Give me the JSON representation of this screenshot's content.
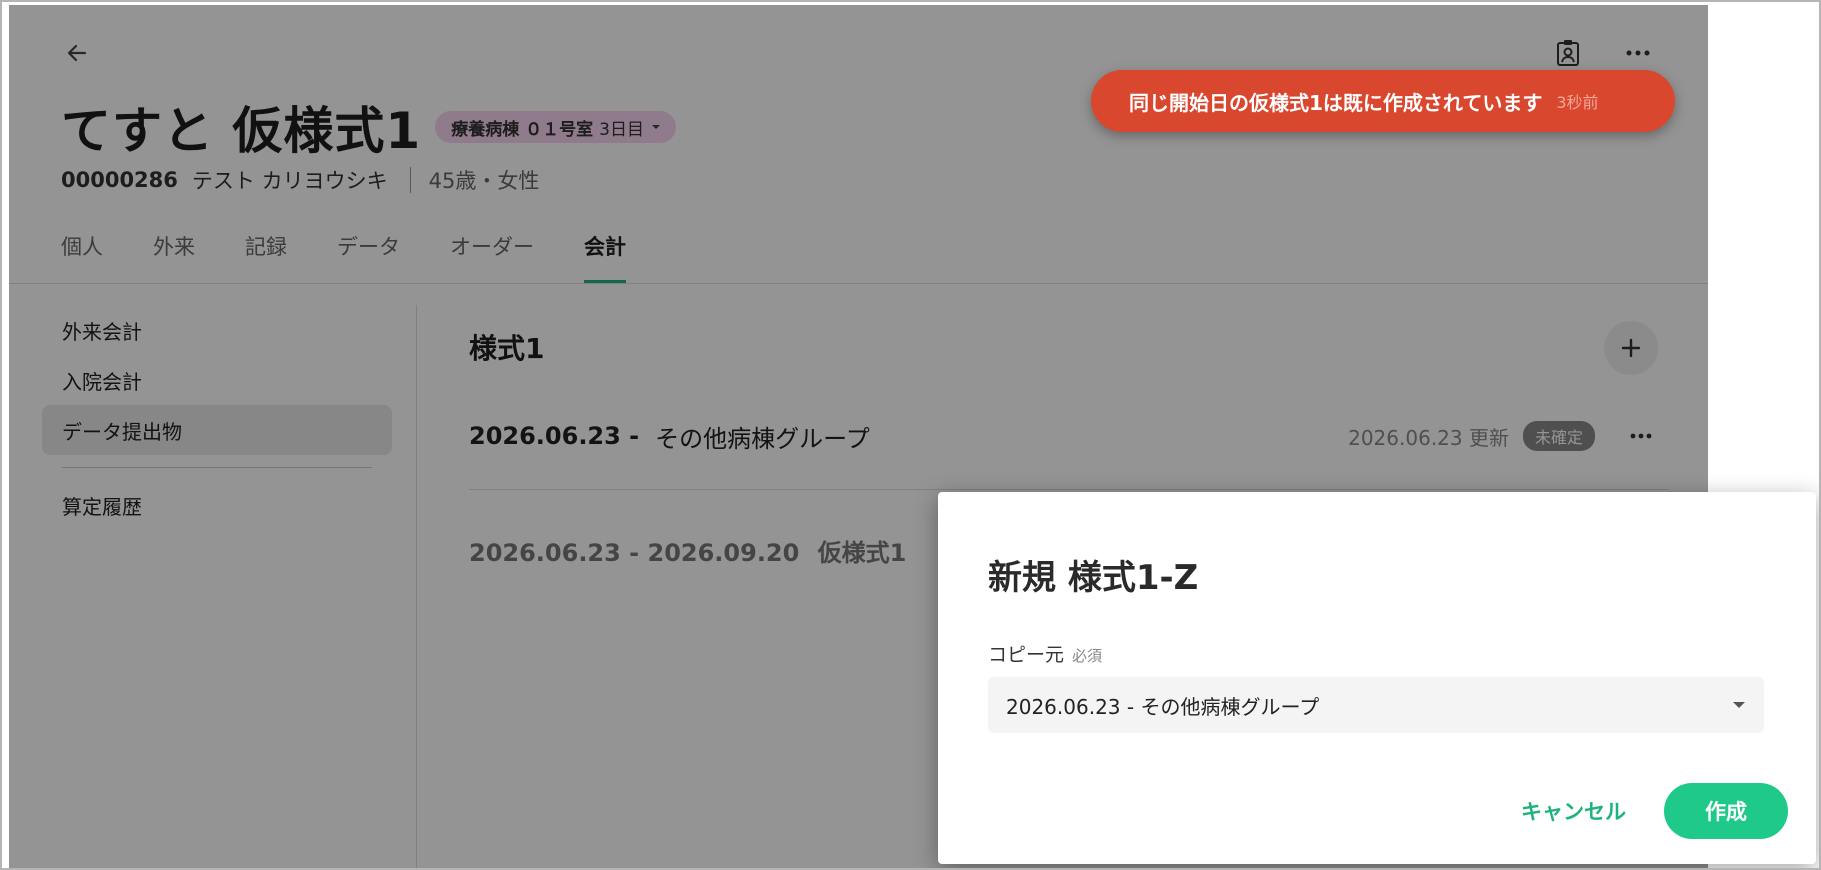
{
  "patient": {
    "name": "てすと 仮様式1",
    "ward_badge": "療養病棟 ０１号室",
    "ward_days": "3日目",
    "id": "00000286",
    "kana": "テスト カリヨウシキ",
    "age_sex": "45歳・女性"
  },
  "tabs": [
    {
      "label": "個人"
    },
    {
      "label": "外来"
    },
    {
      "label": "記録"
    },
    {
      "label": "データ"
    },
    {
      "label": "オーダー"
    },
    {
      "label": "会計",
      "active": true
    }
  ],
  "sidenav": {
    "items": [
      {
        "label": "外来会計"
      },
      {
        "label": "入院会計"
      },
      {
        "label": "データ提出物",
        "active": true
      }
    ],
    "history": "算定履歴"
  },
  "main": {
    "section_title": "様式1",
    "rows": [
      {
        "date": "2026.06.23 -",
        "group": "その他病棟グループ",
        "updated": "2026.06.23 更新",
        "status": "未確定"
      },
      {
        "date": "2026.06.23 - 2026.09.20",
        "label": "仮様式1"
      }
    ]
  },
  "toast": {
    "message": "同じ開始日の仮様式1は既に作成されています",
    "time": "3秒前",
    "color": "#d9472f"
  },
  "dialog": {
    "title": "新規 様式1-Z",
    "field_label": "コピー元",
    "required": "必須",
    "select_value": "2026.06.23 - その他病棟グループ",
    "cancel_label": "キャンセル",
    "create_label": "作成",
    "accent": "#1ec98a"
  },
  "icons": {
    "back": "arrow-left-icon",
    "profile": "contact-card-icon",
    "more": "more-horizontal-icon",
    "add": "plus-icon",
    "dropdown": "caret-down-icon"
  }
}
